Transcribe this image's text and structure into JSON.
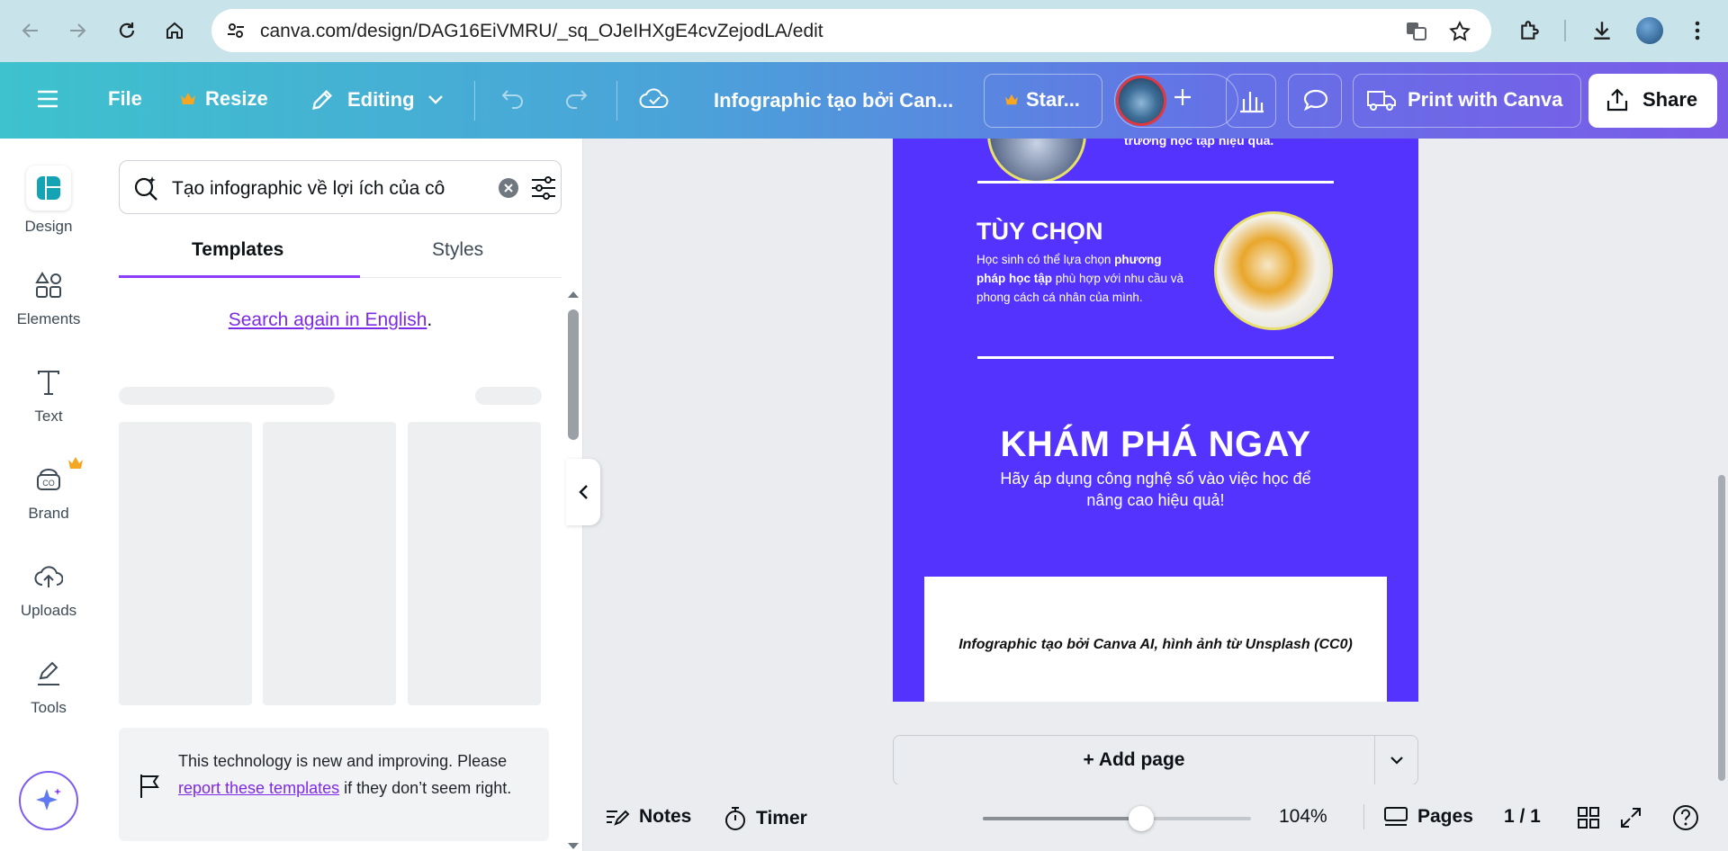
{
  "browser": {
    "url": "canva.com/design/DAG16EiVMRU/_sq_OJeIHXgE4cvZejodLA/edit"
  },
  "topbar": {
    "file_label": "File",
    "resize_label": "Resize",
    "editing_label": "Editing",
    "doc_title": "Infographic tạo bởi Can...",
    "star_label": "Star...",
    "print_label": "Print with Canva",
    "share_label": "Share"
  },
  "sidebar": {
    "items": [
      {
        "label": "Design",
        "icon": "design-icon"
      },
      {
        "label": "Elements",
        "icon": "elements-icon"
      },
      {
        "label": "Text",
        "icon": "text-icon"
      },
      {
        "label": "Brand",
        "icon": "brand-icon"
      },
      {
        "label": "Uploads",
        "icon": "uploads-icon"
      },
      {
        "label": "Tools",
        "icon": "tools-icon"
      }
    ]
  },
  "panel": {
    "search_value": "Tạo infographic về lợi ích của cô",
    "tabs": [
      "Templates",
      "Styles"
    ],
    "search_again_link": "Search again in English",
    "search_again_period": ".",
    "notice_text_1": "This technology is new and improving. Please",
    "notice_link": "report these templates",
    "notice_text_2": "if they don’t seem right."
  },
  "design": {
    "top_fragment": "trường học tập hiệu quả.",
    "option_title": "TÙY CHỌN",
    "option_body_1": "Học sinh có thể lựa chọn ",
    "option_body_bold": "phương pháp học tập",
    "option_body_2": " phù hợp với nhu cầu và phong cách cá nhân của mình.",
    "cta_title": "KHÁM PHÁ NGAY",
    "cta_body": "Hãy áp dụng công nghệ số vào việc học để nâng cao hiệu quả!",
    "footer_text": "Infographic tạo bởi Canva AI, hình ảnh từ Unsplash (CC0)"
  },
  "bottom": {
    "add_page": "+ Add page",
    "notes": "Notes",
    "timer": "Timer",
    "zoom": "104%",
    "zoom_fraction": 0.59,
    "pages": "Pages",
    "page_count": "1 / 1"
  },
  "colors": {
    "accent": "#8b3dff",
    "page_bg": "#5533ff",
    "circle_border": "#e8e06a",
    "crown": "#f5a623"
  }
}
